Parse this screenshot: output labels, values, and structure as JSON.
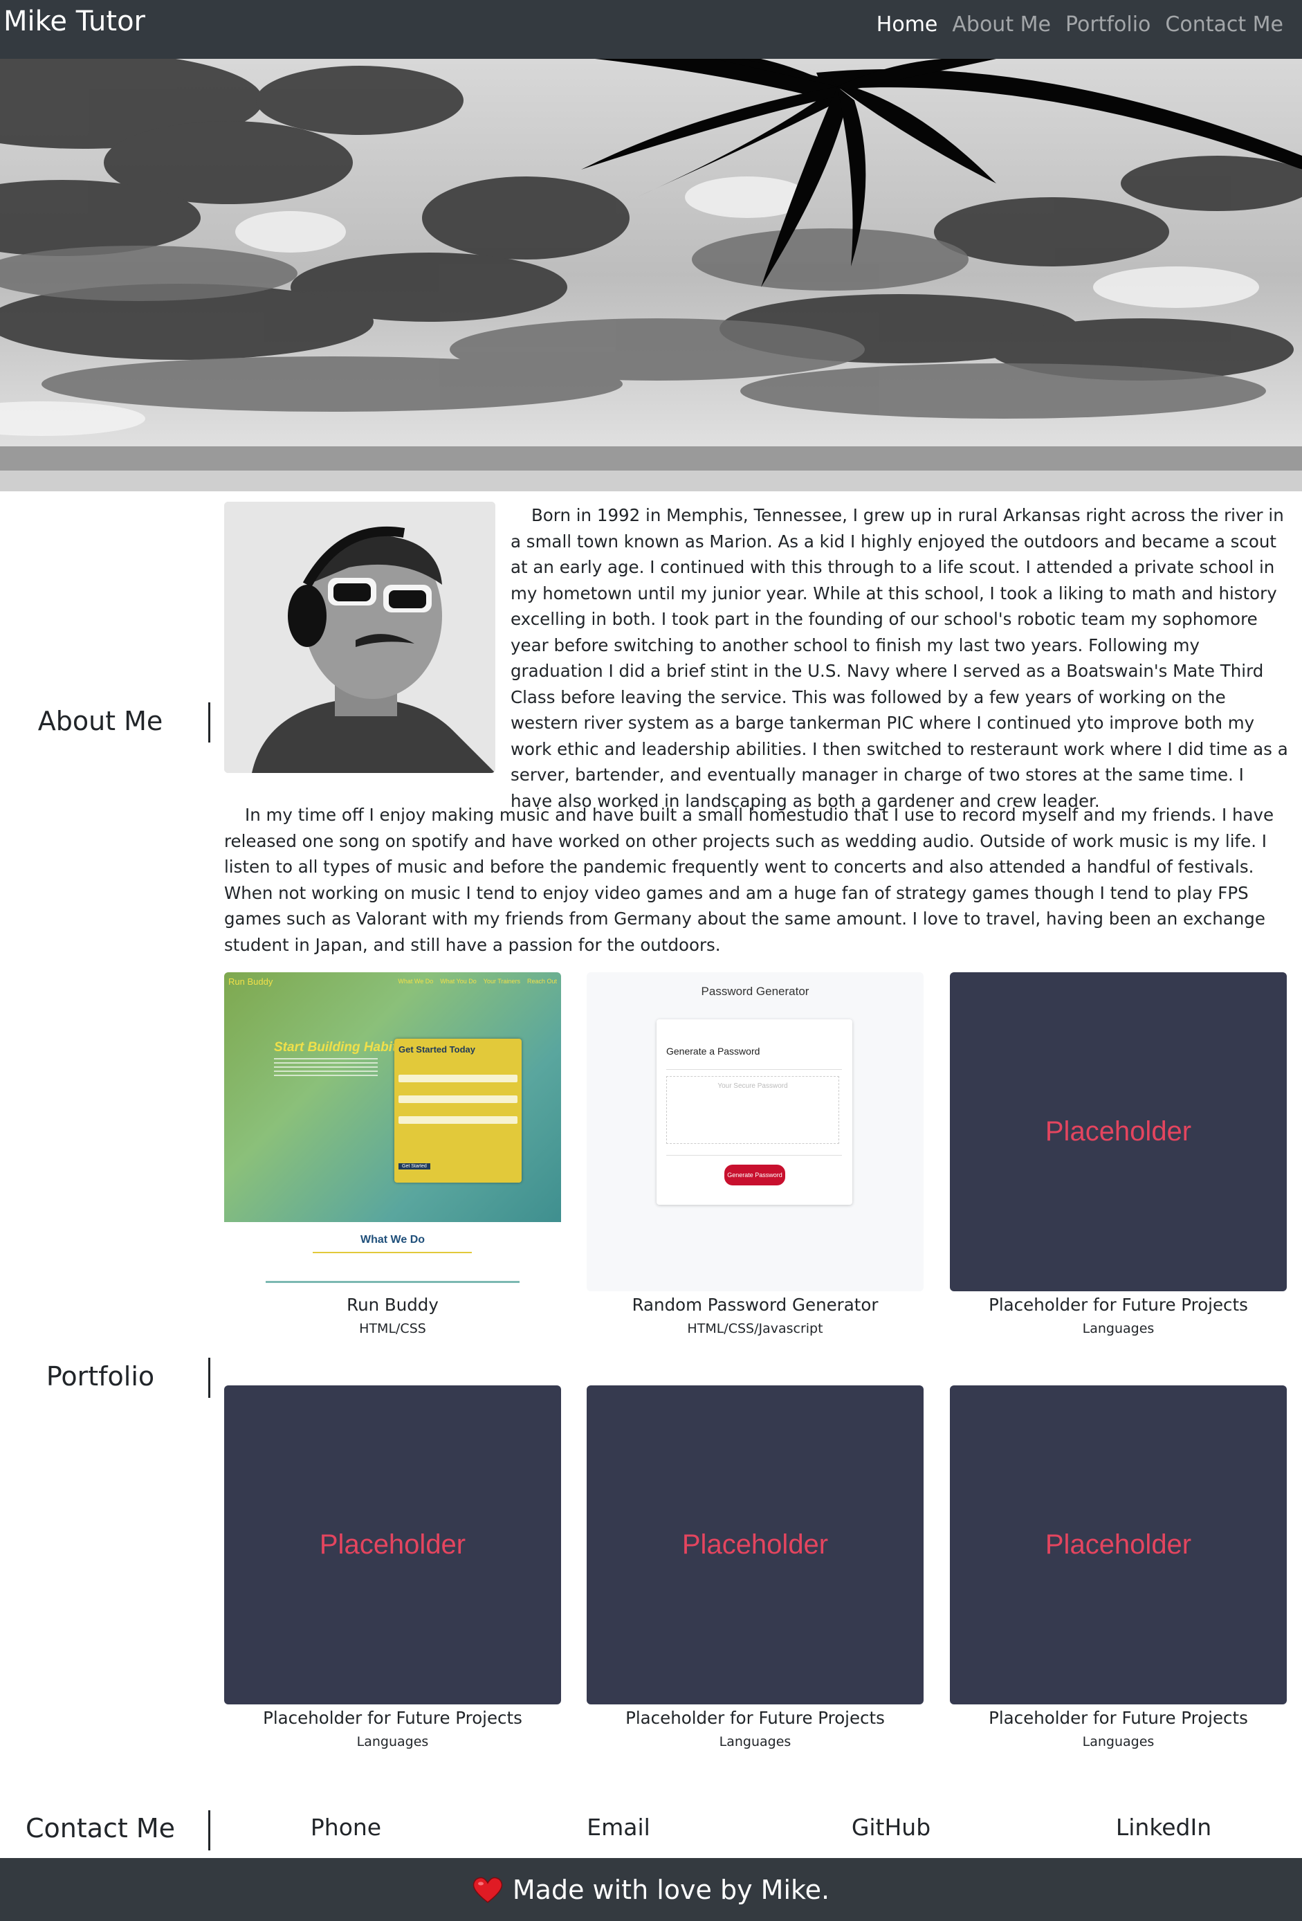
{
  "nav": {
    "brand": "Mike Tutor",
    "links": [
      "Home",
      "About Me",
      "Portfolio",
      "Contact Me"
    ],
    "active": "Home"
  },
  "about": {
    "label": "About Me",
    "p1": "Born in 1992 in Memphis, Tennessee, I grew up in rural Arkansas right across the river in a small town known as Marion. As a kid I highly enjoyed the outdoors and became a scout at an early age. I continued with this through to a life scout. I attended a private school in my hometown until my junior year. While at this school, I took a liking to math and history excelling in both. I took part in the founding of our school's robotic team my sophomore year before switching to another school to finish my last two years. Following my graduation I did a brief stint in the U.S. Navy where I served as a Boatswain's Mate Third Class before leaving the service. This was followed by a few years of working on the western river system as a barge tankerman PIC where I continued yto improve both my work ethic and leadership abilities. I then switched to resteraunt work where I did time as a server, bartender, and eventually manager in charge of two stores at the same time. I have also worked in landscaping as both a gardener and crew leader.",
    "p2": "In my time off I enjoy making music and have built a small homestudio that I use to record myself and my friends. I have released one song on spotify and have worked on other projects such as wedding audio. Outside of work music is my life. I listen to all types of music and before the pandemic frequently went to concerts and also attended a handful of festivals. When not working on music I tend to enjoy video games and am a huge fan of strategy games though I tend to play FPS games such as Valorant with my friends from Germany about the same amount. I love to travel, having been an exchange student in Japan, and still have a passion for the outdoors."
  },
  "portfolio": {
    "label": "Portfolio",
    "projects": [
      {
        "title": "Run Buddy",
        "languages": "HTML/CSS",
        "shot": {
          "logo": "Run Buddy",
          "nav": [
            "What We Do",
            "What You Do",
            "Your Trainers",
            "Reach Out"
          ],
          "headline": "Start Building Habits.",
          "form_title": "Get Started Today",
          "form_button": "Get Started",
          "section_title": "What We Do"
        }
      },
      {
        "title": "Random Password Generator",
        "languages": "HTML/CSS/Javascript",
        "shot": {
          "heading": "Password Generator",
          "card_title": "Generate a Password",
          "placeholder": "Your Secure Password",
          "button": "Generate Password"
        }
      },
      {
        "title": "Placeholder for Future Projects",
        "languages": "Languages",
        "placeholder": "Placeholder"
      },
      {
        "title": "Placeholder for Future Projects",
        "languages": "Languages",
        "placeholder": "Placeholder"
      },
      {
        "title": "Placeholder for Future Projects",
        "languages": "Languages",
        "placeholder": "Placeholder"
      },
      {
        "title": "Placeholder for Future Projects",
        "languages": "Languages",
        "placeholder": "Placeholder"
      }
    ]
  },
  "contact": {
    "label": "Contact Me",
    "links": [
      "Phone",
      "Email",
      "GitHub",
      "LinkedIn"
    ]
  },
  "footer": {
    "text": "Made with love by Mike.",
    "icon": "heart-icon"
  },
  "colors": {
    "navbar": "#343a40",
    "placeholder_bg": "#363a4f",
    "placeholder_text": "#e4455f",
    "heart": "#e01b24"
  }
}
